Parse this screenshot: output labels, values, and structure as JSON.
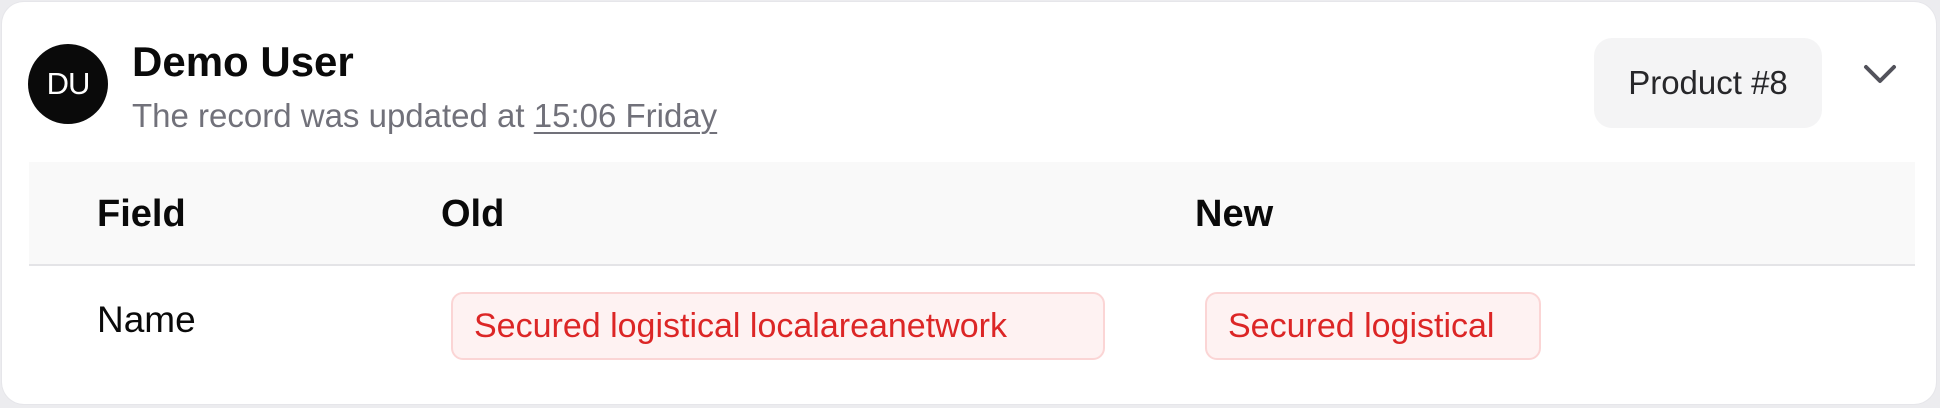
{
  "user": {
    "initials": "DU",
    "name": "Demo User",
    "subtitle_prefix": "The record was updated at ",
    "timestamp": "15:06 Friday"
  },
  "badge": {
    "label": "Product #8"
  },
  "icons": {
    "expand": "chevron-down-icon"
  },
  "table": {
    "headers": [
      "Field",
      "Old",
      "New"
    ],
    "rows": [
      {
        "field": "Name",
        "old": "Secured logistical localareanetwork",
        "new": "Secured logistical"
      }
    ]
  },
  "colors": {
    "chip_text": "#dc2626",
    "chip_bg": "#fef2f2",
    "chip_border": "#fbd5d5",
    "avatar_bg": "#0a0a0a",
    "badge_bg": "#f4f4f5"
  }
}
